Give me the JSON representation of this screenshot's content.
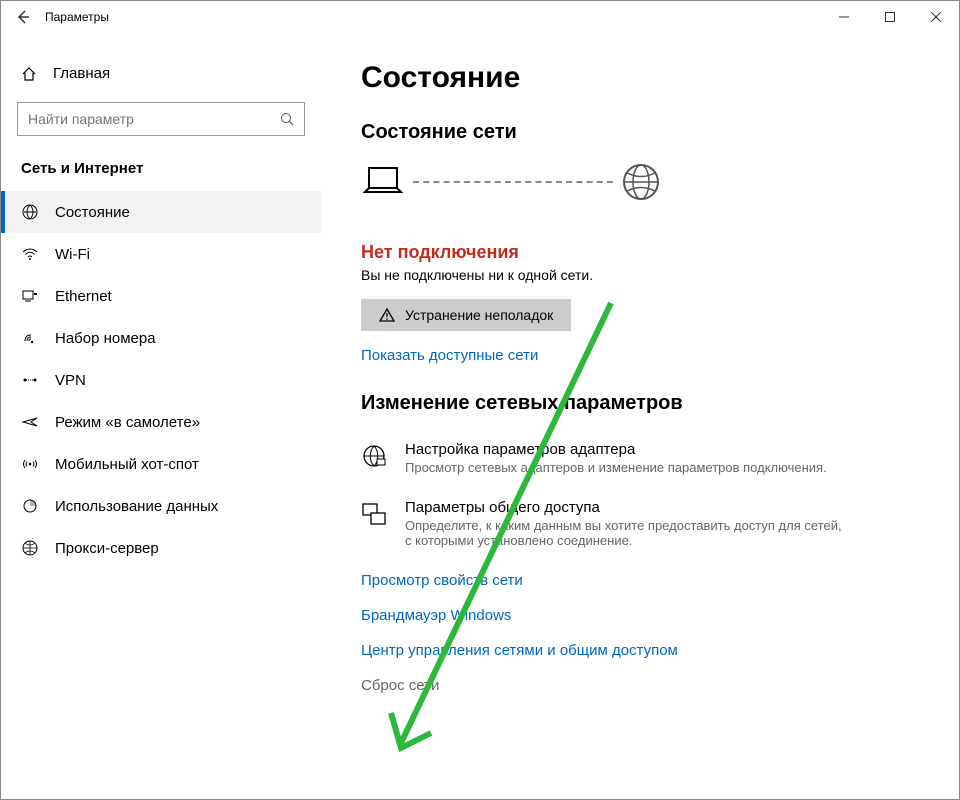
{
  "window": {
    "title": "Параметры"
  },
  "sidebar": {
    "home": "Главная",
    "search_placeholder": "Найти параметр",
    "section": "Сеть и Интернет",
    "items": [
      {
        "label": "Состояние"
      },
      {
        "label": "Wi-Fi"
      },
      {
        "label": "Ethernet"
      },
      {
        "label": "Набор номера"
      },
      {
        "label": "VPN"
      },
      {
        "label": "Режим «в самолете»"
      },
      {
        "label": "Мобильный хот-спот"
      },
      {
        "label": "Использование данных"
      },
      {
        "label": "Прокси-сервер"
      }
    ]
  },
  "main": {
    "heading": "Состояние",
    "netstatus_heading": "Состояние сети",
    "no_connection": "Нет подключения",
    "no_connection_sub": "Вы не подключены ни к одной сети.",
    "troubleshoot": "Устранение неполадок",
    "show_networks": "Показать доступные сети",
    "change_heading": "Изменение сетевых параметров",
    "adapter_title": "Настройка параметров адаптера",
    "adapter_desc": "Просмотр сетевых адаптеров и изменение параметров подключения.",
    "sharing_title": "Параметры общего доступа",
    "sharing_desc": "Определите, к каким данным вы хотите предоставить доступ для сетей, с которыми установлено соединение.",
    "link_props": "Просмотр свойств сети",
    "link_firewall": "Брандмауэр Windows",
    "link_center": "Центр управления сетями и общим доступом",
    "reset": "Сброс сети"
  },
  "annotation": {
    "arrow_color": "#2db83d"
  }
}
